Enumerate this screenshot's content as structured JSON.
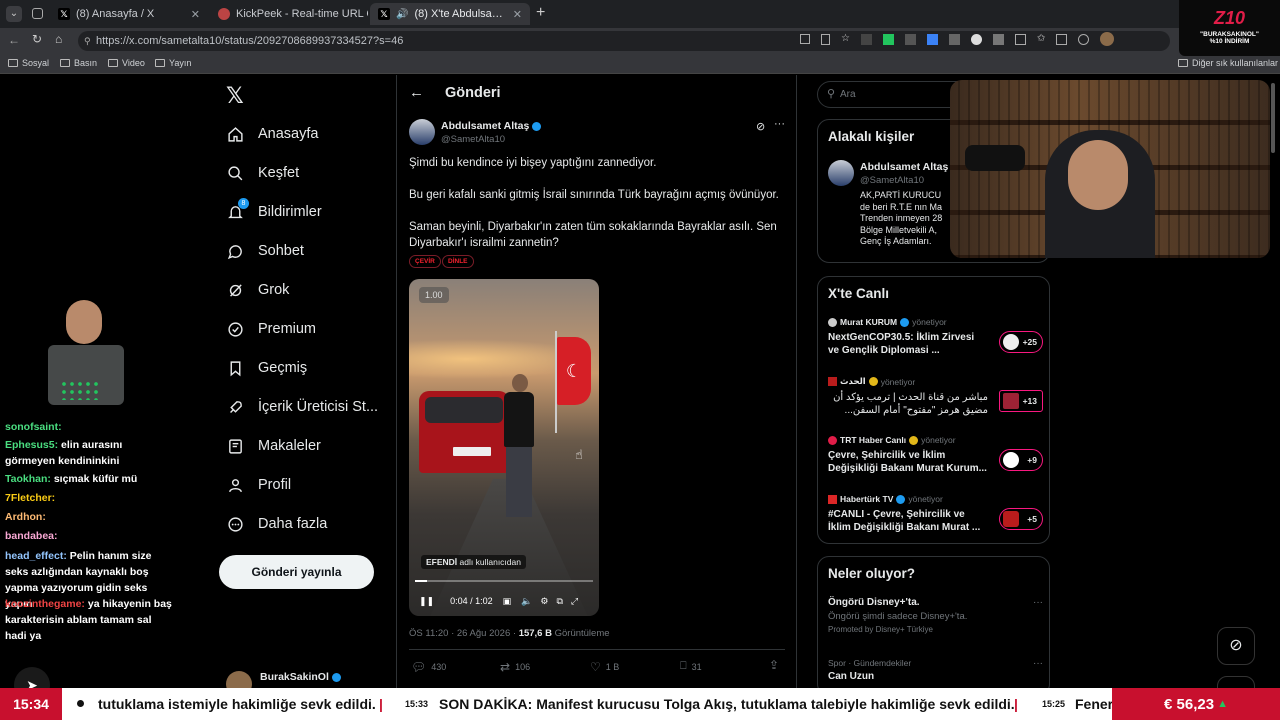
{
  "browser": {
    "tabs": [
      {
        "label": "(8) Anasayfa / X"
      },
      {
        "label": "KickPeek - Real-time URL Crawler"
      },
      {
        "label": "(8) X'te Abdulsamet Altaş: \"Şi..."
      }
    ],
    "url": "https://x.com/sametalta10/status/2092708689937334527?s=46",
    "bookmarks": [
      "Sosyal",
      "Basın",
      "Video",
      "Yayın"
    ],
    "bookmarks_right": "Diğer sık kullanılanlar"
  },
  "nav": {
    "items": [
      "Anasayfa",
      "Keşfet",
      "Bildirimler",
      "Sohbet",
      "Grok",
      "Premium",
      "Geçmiş",
      "İçerik Üreticisi St...",
      "Makaleler",
      "Profil",
      "Daha fazla"
    ],
    "notif_count": "8",
    "post_button": "Gönderi yayınla",
    "account_name": "BurakSakinOl"
  },
  "post": {
    "header": "Gönderi",
    "author_name": "Abdulsamet Altaş",
    "author_handle": "@SametAlta10",
    "paragraphs": [
      "Şimdi bu kendince iyi bişey yaptığını zannediyor.",
      "Bu geri kafalı sanki gitmiş İsrail sınırında Türk bayrağını açmış övünüyor.",
      "Saman beyinli, Diyarbakır'ın zaten tüm sokaklarında Bayraklar asılı. Sen Diyarbakır'ı israilmi zannetin?"
    ],
    "translate_label": "ÇEVİR",
    "listen_label": "DİNLE",
    "video": {
      "speed": "1.00",
      "watermark_user": "EFENDİ",
      "watermark_rest": "adlı kullanıcıdan",
      "time": "0:04 / 1:02",
      "progress": 0.065
    },
    "meta_time": "ÖS 11:20 · 26 Ağu 2026 · ",
    "meta_views": "157,6 B",
    "meta_views_label": " Görüntüleme",
    "stats": {
      "replies": "430",
      "reposts": "106",
      "likes": "1 B",
      "bookmarks": "31"
    }
  },
  "right": {
    "search_placeholder": "Ara",
    "related_title": "Alakalı kişiler",
    "related_name": "Abdulsamet Altaş",
    "related_handle": "@SametAlta10",
    "related_bio": [
      "AK,PARTİ KURUCU",
      "de beri R.T.E nın Ma",
      "Trenden inmeyen 28",
      "Bölge Milletvekili A,",
      "Genç İş Adamları."
    ],
    "live_title": "X'te Canlı",
    "live_items": [
      {
        "host": "Murat KURUM",
        "role": "yönetiyor",
        "title": "NextGenCOP30.5: İklim Zirvesi ve Gençlik Diplomasi ...",
        "count": "+25"
      },
      {
        "host": "الحدث",
        "role": "yönetiyor",
        "title": "مباشر من قناة الحدث | ترمب يؤكد أن مضيق هرمز \"مفتوح\" أمام السفن...",
        "count": "+13"
      },
      {
        "host": "TRT Haber Canlı",
        "role": "yönetiyor",
        "title": "Çevre, Şehircilik ve İklim Değişikliği Bakanı Murat Kurum...",
        "count": "+9"
      },
      {
        "host": "Habertürk TV",
        "role": "yönetiyor",
        "title": "#CANLI - Çevre, Şehircilik ve İklim Değişikliği Bakanı Murat ...",
        "count": "+5"
      }
    ],
    "trends_title": "Neler oluyor?",
    "trend1_title": "Öngörü Disney+'ta.",
    "trend1_sub": "Öngörü şimdi sadece Disney+'ta.",
    "trend1_promo": "Promoted by Disney+ Türkiye",
    "trend2_cat": "Spor · Gündemdekiler",
    "trend2_title": "Can Uzun"
  },
  "overlay": {
    "brand_title": "Z10",
    "brand_line1": "\"BURAKSAKINOL\"",
    "brand_line2": "%10 İNDİRİM"
  },
  "chat": [
    {
      "user": "sonofsaint:",
      "color": "#4ade80",
      "text": ""
    },
    {
      "user": "Ephesus5:",
      "color": "#4ade80",
      "text": "elin aurasını görmeyen kendininkini"
    },
    {
      "user": "Taokhan:",
      "color": "#4ade80",
      "text": "sıçmak küfür mü"
    },
    {
      "user": "7Fletcher:",
      "color": "#facc15",
      "text": ""
    },
    {
      "user": "Ardhon:",
      "color": "#fdba74",
      "text": ""
    },
    {
      "user": "bandabea:",
      "color": "#f9a8d4",
      "text": ""
    },
    {
      "user": "head_effect:",
      "color": "#93c5fd",
      "text": "Pelin hanım size seks azlığından kaynaklı boş yapma yazıyorum gidin seks yapın"
    },
    {
      "user": "koozinthegame:",
      "color": "#ef4444",
      "text": "ya hikayenin baş karakterisin ablam tamam sal hadi ya"
    }
  ],
  "ticker": {
    "time": "15:34",
    "text1": "tutuklama istemiyle hakimliğe sevk edildi.",
    "stamp1": "15:33",
    "text2": "SON DAKİKA: Manifest kurucusu Tolga Akış, tutuklama talebiyle hakimliğe sevk edildi.",
    "stamp2": "15:25",
    "text3": "Fener",
    "eur": "€ 56,23"
  }
}
